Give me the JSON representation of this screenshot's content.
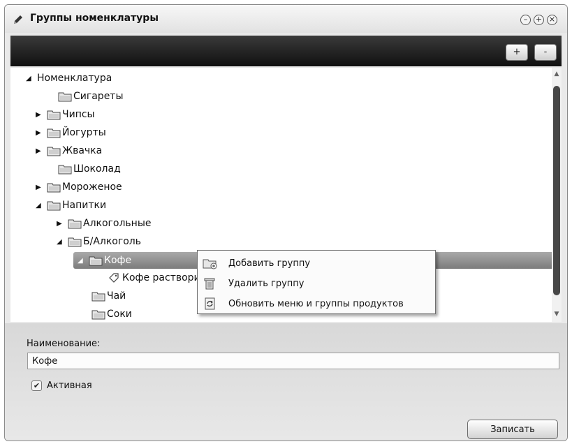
{
  "window": {
    "title": "Группы номенклатуры",
    "controls": [
      "–",
      "+",
      "×"
    ]
  },
  "toolbar": {
    "add_label": "+",
    "remove_label": "-"
  },
  "tree": {
    "root": "Номенклатура",
    "items": [
      {
        "label": "Сигареты"
      },
      {
        "label": "Чипсы"
      },
      {
        "label": "Йогурты"
      },
      {
        "label": "Жвачка"
      },
      {
        "label": "Шоколад"
      },
      {
        "label": "Мороженое"
      },
      {
        "label": "Напитки"
      },
      {
        "label": "Алкогольные"
      },
      {
        "label": "Б/Алкоголь"
      },
      {
        "label": "Кофе"
      },
      {
        "label": "Кофе раствори"
      },
      {
        "label": "Чай"
      },
      {
        "label": "Соки"
      }
    ]
  },
  "context_menu": {
    "items": [
      {
        "label": "Добавить группу",
        "icon": "add-folder-icon"
      },
      {
        "label": "Удалить группу",
        "icon": "trash-icon"
      },
      {
        "label": "Обновить меню и группы продуктов",
        "icon": "refresh-icon"
      }
    ]
  },
  "form": {
    "name_label": "Наименование:",
    "name_value": "Кофе",
    "active_label": "Активная",
    "active_checked": true,
    "save_label": "Записать"
  },
  "colors": {
    "toolbar_bg": "#1a1a1a",
    "selection_bg": "#8f8f8f"
  }
}
